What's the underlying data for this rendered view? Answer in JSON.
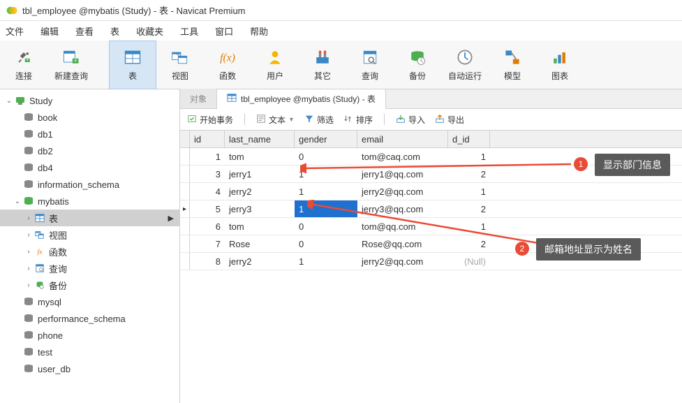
{
  "window": {
    "title": "tbl_employee @mybatis (Study) - 表 - Navicat Premium"
  },
  "menubar": {
    "items": [
      "文件",
      "编辑",
      "查看",
      "表",
      "收藏夹",
      "工具",
      "窗口",
      "帮助"
    ]
  },
  "toolbar": {
    "items": [
      {
        "label": "连接",
        "icon": "plug-icon"
      },
      {
        "label": "新建查询",
        "icon": "new-query-icon"
      },
      {
        "label": "表",
        "icon": "table-icon",
        "active": true
      },
      {
        "label": "视图",
        "icon": "view-icon"
      },
      {
        "label": "函数",
        "icon": "function-icon"
      },
      {
        "label": "用户",
        "icon": "user-icon"
      },
      {
        "label": "其它",
        "icon": "other-icon"
      },
      {
        "label": "查询",
        "icon": "query-icon"
      },
      {
        "label": "备份",
        "icon": "backup-icon"
      },
      {
        "label": "自动运行",
        "icon": "autorun-icon"
      },
      {
        "label": "模型",
        "icon": "model-icon"
      },
      {
        "label": "图表",
        "icon": "chart-icon"
      }
    ]
  },
  "sidebar": {
    "root": {
      "label": "Study",
      "expanded": true
    },
    "databases": [
      {
        "label": "book"
      },
      {
        "label": "db1"
      },
      {
        "label": "db2"
      },
      {
        "label": "db4"
      },
      {
        "label": "information_schema"
      },
      {
        "label": "mybatis",
        "expanded": true,
        "active": true,
        "children": [
          {
            "label": "表",
            "icon": "table-icon",
            "selected": true
          },
          {
            "label": "视图",
            "icon": "view-icon"
          },
          {
            "label": "函数",
            "icon": "function-icon"
          },
          {
            "label": "查询",
            "icon": "query-icon"
          },
          {
            "label": "备份",
            "icon": "backup-icon"
          }
        ]
      },
      {
        "label": "mysql"
      },
      {
        "label": "performance_schema"
      },
      {
        "label": "phone"
      },
      {
        "label": "test"
      },
      {
        "label": "user_db"
      }
    ]
  },
  "tabs": {
    "items": [
      {
        "label": "对象",
        "active": false
      },
      {
        "label": "tbl_employee @mybatis (Study) - 表",
        "active": true,
        "icon": "table-icon"
      }
    ]
  },
  "table_toolbar": {
    "begin_tx": "开始事务",
    "text": "文本",
    "filter": "筛选",
    "sort": "排序",
    "import": "导入",
    "export": "导出"
  },
  "table": {
    "columns": [
      "id",
      "last_name",
      "gender",
      "email",
      "d_id"
    ],
    "rows": [
      {
        "id": "1",
        "last_name": "tom",
        "gender": "0",
        "email": "tom@caq.com",
        "d_id": "1"
      },
      {
        "id": "3",
        "last_name": "jerry1",
        "gender": "1",
        "email": "jerry1@qq.com",
        "d_id": "2"
      },
      {
        "id": "4",
        "last_name": "jerry2",
        "gender": "1",
        "email": "jerry2@qq.com",
        "d_id": "1"
      },
      {
        "id": "5",
        "last_name": "jerry3",
        "gender": "1",
        "email": "jerry3@qq.com",
        "d_id": "2",
        "current": true,
        "selected_col": "gender"
      },
      {
        "id": "6",
        "last_name": "tom",
        "gender": "0",
        "email": "tom@qq.com",
        "d_id": "1"
      },
      {
        "id": "7",
        "last_name": "Rose",
        "gender": "0",
        "email": "Rose@qq.com",
        "d_id": "2"
      },
      {
        "id": "8",
        "last_name": "jerry2",
        "gender": "1",
        "email": "jerry2@qq.com",
        "d_id": "(Null)",
        "d_id_null": true
      }
    ]
  },
  "annotations": {
    "a1": {
      "num": "1",
      "text": "显示部门信息"
    },
    "a2": {
      "num": "2",
      "text": "邮箱地址显示为姓名"
    }
  }
}
